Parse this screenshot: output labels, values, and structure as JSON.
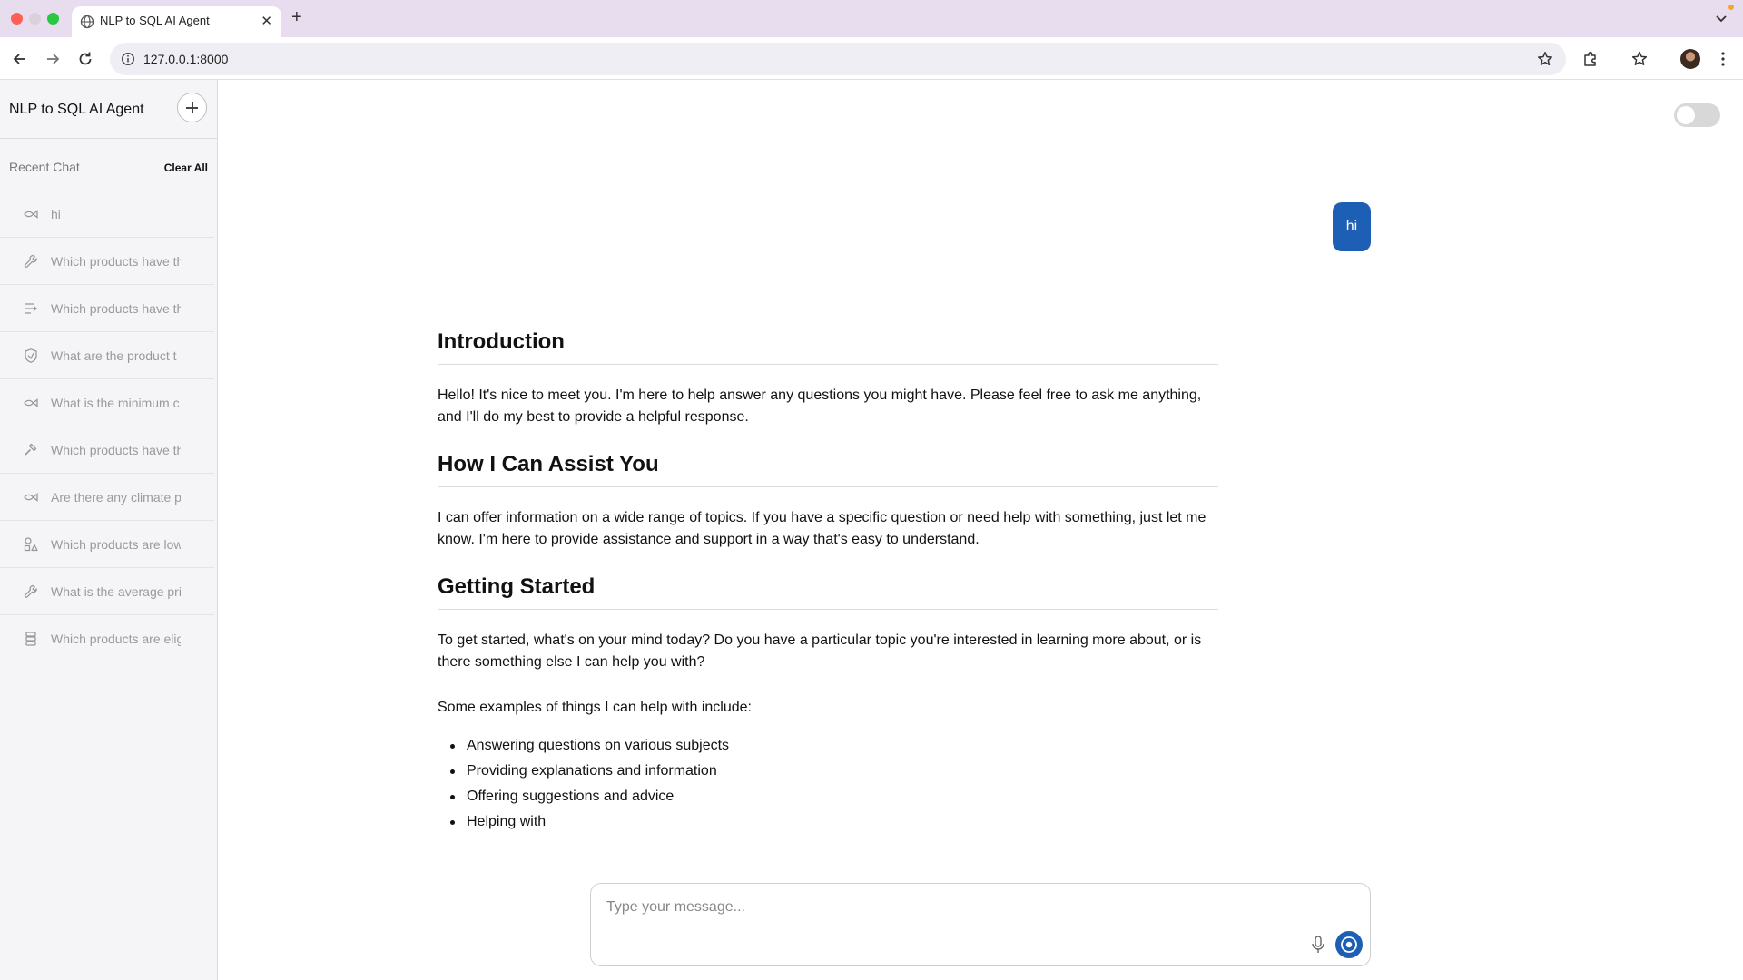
{
  "browser": {
    "tab_title": "NLP to SQL AI Agent",
    "url": "127.0.0.1:8000"
  },
  "sidebar": {
    "app_title": "NLP to SQL AI Agent",
    "recent_label": "Recent Chat",
    "clear_all_label": "Clear All",
    "items": [
      {
        "label": "hi",
        "icon": "fish-icon"
      },
      {
        "label": "Which products have th",
        "icon": "wrench-icon"
      },
      {
        "label": "Which products have th",
        "icon": "list-arrow-icon"
      },
      {
        "label": "What are the product t",
        "icon": "shield-icon"
      },
      {
        "label": "What is the minimum c",
        "icon": "fish-icon"
      },
      {
        "label": "Which products have th",
        "icon": "hammer-icon"
      },
      {
        "label": "Are there any climate p",
        "icon": "fish-icon"
      },
      {
        "label": "Which products are low",
        "icon": "shapes-icon"
      },
      {
        "label": "What is the average pri",
        "icon": "wrench-icon"
      },
      {
        "label": "Which products are elig",
        "icon": "cube-stack-icon"
      }
    ]
  },
  "chat": {
    "user_message": "hi",
    "intro_heading": "Introduction",
    "intro_text": "Hello! It's nice to meet you. I'm here to help answer any questions you might have. Please feel free to ask me anything, and I'll do my best to provide a helpful response.",
    "assist_heading": "How I Can Assist You",
    "assist_text": "I can offer information on a wide range of topics. If you have a specific question or need help with something, just let me know. I'm here to provide assistance and support in a way that's easy to understand.",
    "start_heading": "Getting Started",
    "start_text": "To get started, what's on your mind today? Do you have a particular topic you're interested in learning more about, or is there something else I can help you with?",
    "examples_intro": "Some examples of things I can help with include:",
    "examples": [
      "Answering questions on various subjects",
      "Providing explanations and information",
      "Offering suggestions and advice",
      "Helping with"
    ]
  },
  "composer": {
    "placeholder": "Type your message..."
  }
}
